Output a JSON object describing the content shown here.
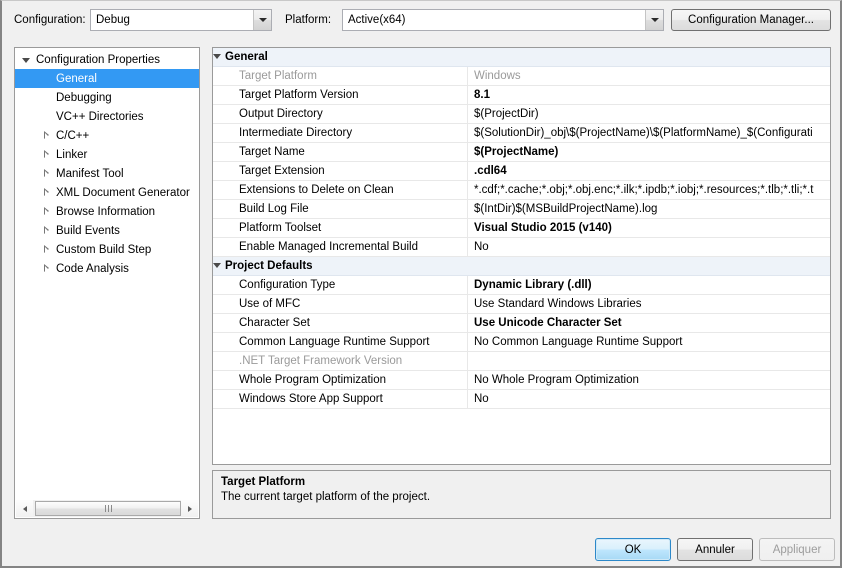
{
  "toolbar": {
    "configuration_label": "Configuration:",
    "configuration_value": "Debug",
    "platform_label": "Platform:",
    "platform_value": "Active(x64)",
    "configuration_manager_label": "Configuration Manager..."
  },
  "tree": {
    "items": [
      {
        "label": "Configuration Properties",
        "indent": 0,
        "expander": "open",
        "selected": false
      },
      {
        "label": "General",
        "indent": 1,
        "expander": "none",
        "selected": true
      },
      {
        "label": "Debugging",
        "indent": 1,
        "expander": "none",
        "selected": false
      },
      {
        "label": "VC++ Directories",
        "indent": 1,
        "expander": "none",
        "selected": false
      },
      {
        "label": "C/C++",
        "indent": 1,
        "expander": "closed",
        "selected": false
      },
      {
        "label": "Linker",
        "indent": 1,
        "expander": "closed",
        "selected": false
      },
      {
        "label": "Manifest Tool",
        "indent": 1,
        "expander": "closed",
        "selected": false
      },
      {
        "label": "XML Document Generator",
        "indent": 1,
        "expander": "closed",
        "selected": false
      },
      {
        "label": "Browse Information",
        "indent": 1,
        "expander": "closed",
        "selected": false
      },
      {
        "label": "Build Events",
        "indent": 1,
        "expander": "closed",
        "selected": false
      },
      {
        "label": "Custom Build Step",
        "indent": 1,
        "expander": "closed",
        "selected": false
      },
      {
        "label": "Code Analysis",
        "indent": 1,
        "expander": "closed",
        "selected": false
      }
    ]
  },
  "grid": {
    "rows": [
      {
        "type": "section",
        "name": "General",
        "value": ""
      },
      {
        "type": "prop",
        "name": "Target Platform",
        "value": "Windows",
        "name_dim": true,
        "value_dim": true,
        "bold": false
      },
      {
        "type": "prop",
        "name": "Target Platform Version",
        "value": "8.1",
        "bold": true
      },
      {
        "type": "prop",
        "name": "Output Directory",
        "value": "$(ProjectDir)",
        "bold": false
      },
      {
        "type": "prop",
        "name": "Intermediate Directory",
        "value": "$(SolutionDir)_obj\\$(ProjectName)\\$(PlatformName)_$(Configurati",
        "bold": false
      },
      {
        "type": "prop",
        "name": "Target Name",
        "value": "$(ProjectName)",
        "bold": true
      },
      {
        "type": "prop",
        "name": "Target Extension",
        "value": ".cdl64",
        "bold": true
      },
      {
        "type": "prop",
        "name": "Extensions to Delete on Clean",
        "value": "*.cdf;*.cache;*.obj;*.obj.enc;*.ilk;*.ipdb;*.iobj;*.resources;*.tlb;*.tli;*.t",
        "bold": false
      },
      {
        "type": "prop",
        "name": "Build Log File",
        "value": "$(IntDir)$(MSBuildProjectName).log",
        "bold": false
      },
      {
        "type": "prop",
        "name": "Platform Toolset",
        "value": "Visual Studio 2015 (v140)",
        "bold": true
      },
      {
        "type": "prop",
        "name": "Enable Managed Incremental Build",
        "value": "No",
        "bold": false
      },
      {
        "type": "section",
        "name": "Project Defaults",
        "value": ""
      },
      {
        "type": "prop",
        "name": "Configuration Type",
        "value": "Dynamic Library (.dll)",
        "bold": true
      },
      {
        "type": "prop",
        "name": "Use of MFC",
        "value": "Use Standard Windows Libraries",
        "bold": false
      },
      {
        "type": "prop",
        "name": "Character Set",
        "value": "Use Unicode Character Set",
        "bold": true
      },
      {
        "type": "prop",
        "name": "Common Language Runtime Support",
        "value": "No Common Language Runtime Support",
        "bold": false
      },
      {
        "type": "prop",
        "name": ".NET Target Framework Version",
        "value": "",
        "name_dim": true,
        "bold": false
      },
      {
        "type": "prop",
        "name": "Whole Program Optimization",
        "value": "No Whole Program Optimization",
        "bold": false
      },
      {
        "type": "prop",
        "name": "Windows Store App Support",
        "value": "No",
        "bold": false
      }
    ]
  },
  "description": {
    "title": "Target Platform",
    "text": "The current target platform of the project."
  },
  "footer": {
    "ok_label": "OK",
    "cancel_label": "Annuler",
    "apply_label": "Appliquer"
  },
  "colors": {
    "selection": "#3399f3",
    "section_bg": "#eef3f9",
    "dialog_bg": "#f0f0f0"
  }
}
